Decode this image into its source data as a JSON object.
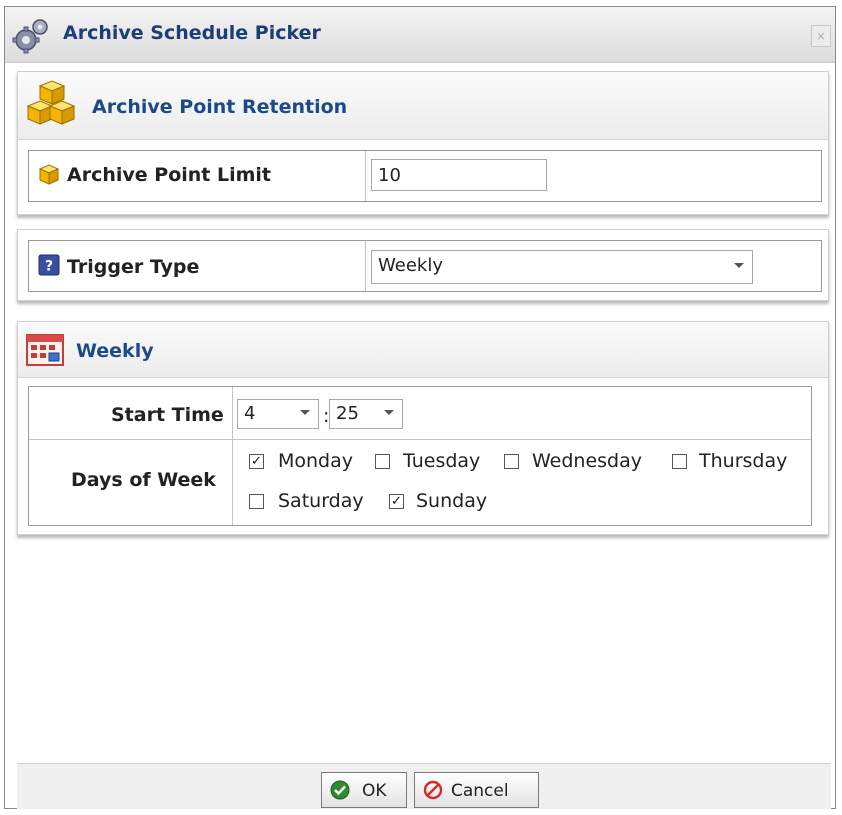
{
  "window": {
    "title": "Archive Schedule Picker",
    "close_label": "×"
  },
  "retention_panel": {
    "title": "Archive Point Retention",
    "limit_label": "Archive Point Limit",
    "limit_value": "10"
  },
  "trigger": {
    "label": "Trigger Type",
    "selected": "Weekly"
  },
  "weekly_panel": {
    "title": "Weekly",
    "start_time_label": "Start Time",
    "hour": "4",
    "separator": ":",
    "minute": "25",
    "days_label": "Days of Week",
    "days": [
      {
        "label": "Monday",
        "checked": true
      },
      {
        "label": "Tuesday",
        "checked": false
      },
      {
        "label": "Wednesday",
        "checked": false
      },
      {
        "label": "Thursday",
        "checked": false
      },
      {
        "label": "Saturday",
        "checked": false
      },
      {
        "label": "Sunday",
        "checked": true
      }
    ]
  },
  "footer": {
    "ok_label": "OK",
    "cancel_label": "Cancel"
  },
  "icons": {
    "title": "gears-icon",
    "retention": "cubes-icon",
    "limit": "cube-icon",
    "trigger": "help-icon",
    "weekly": "calendar-icon",
    "ok": "check-circle-icon",
    "cancel": "no-entry-icon"
  },
  "colors": {
    "title_text": "#1b3d78",
    "panel_title": "#1b4a8a",
    "ok_green": "#2e8b2e",
    "cancel_red": "#d42a2a"
  }
}
